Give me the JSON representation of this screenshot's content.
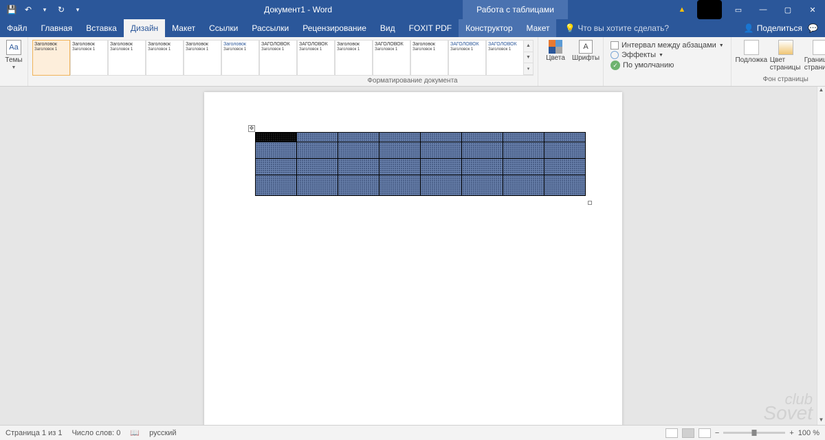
{
  "title": "Документ1  -  Word",
  "table_tools": "Работа с таблицами",
  "qat": {
    "save": "💾",
    "undo": "↶",
    "redo": "↻",
    "more": "▾"
  },
  "window": {
    "ribbon_mode": "▭",
    "minimize": "—",
    "maximize": "▢",
    "close": "✕"
  },
  "tabs": [
    "Файл",
    "Главная",
    "Вставка",
    "Дизайн",
    "Макет",
    "Ссылки",
    "Рассылки",
    "Рецензирование",
    "Вид",
    "FOXIT PDF"
  ],
  "context_tabs": [
    "Конструктор",
    "Макет"
  ],
  "active_tab": "Дизайн",
  "tell_me": "Что вы хотите сделать?",
  "share": "Поделиться",
  "ribbon": {
    "themes": "Темы",
    "gallery_heading": "Заголовок",
    "gallery_heading_caps": "ЗАГОЛОВОК",
    "gallery_sub": "Заголовок 1",
    "colors": "Цвета",
    "fonts": "Шрифты",
    "spacing": "Интервал между абзацами",
    "effects": "Эффекты",
    "default": "По умолчанию",
    "watermark": "Подложка",
    "page_color": "Цвет страницы",
    "borders": "Границы страниц",
    "group_doc_format": "Форматирование документа",
    "group_page_bg": "Фон страницы"
  },
  "status": {
    "page": "Страница 1 из 1",
    "words": "Число слов: 0",
    "lang": "русский",
    "zoom": "100 %"
  },
  "watermark_logo": {
    "top": "club",
    "bottom": "Sovet"
  }
}
